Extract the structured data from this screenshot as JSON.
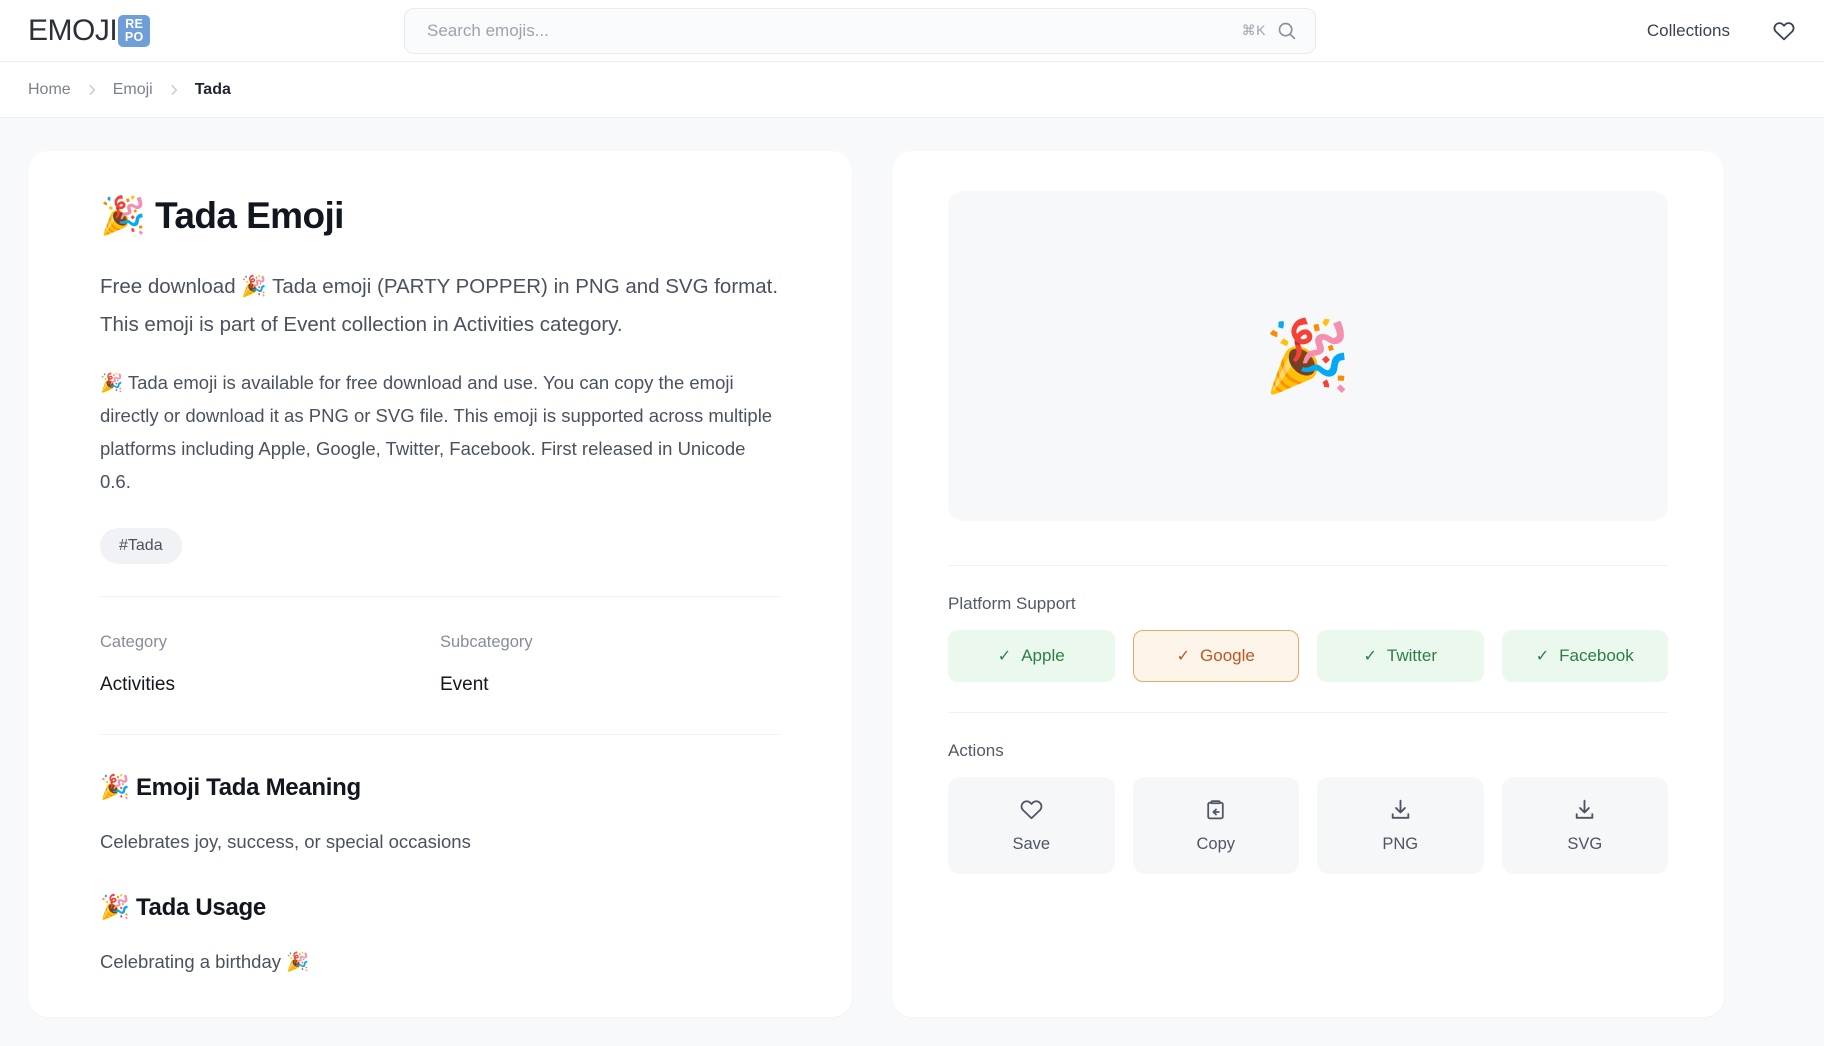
{
  "header": {
    "logo_word": "EMOJI",
    "logo_badge_line1": "RE",
    "logo_badge_line2": "PO",
    "logo_badge_color": "#6f9fd8",
    "search": {
      "placeholder": "Search emojis...",
      "value": "",
      "shortcut": "⌘K",
      "icon": "search-icon"
    },
    "nav": {
      "collections_label": "Collections",
      "favorites_icon": "heart-icon"
    }
  },
  "breadcrumb": {
    "items": [
      {
        "label": "Home",
        "current": false
      },
      {
        "label": "Emoji",
        "current": false
      },
      {
        "label": "Tada",
        "current": true
      }
    ],
    "separator_icon": "chevron-right-icon"
  },
  "left_panel": {
    "title_emoji": "🎉",
    "title": "Tada Emoji",
    "lede": "Free download 🎉 Tada emoji (PARTY POPPER) in PNG and SVG format. This emoji is part of Event collection in Activities category.",
    "body": "🎉 Tada emoji is available for free download and use. You can copy the emoji directly or download it as PNG or SVG file. This emoji is supported across multiple platforms including Apple, Google, Twitter, Facebook. First released in Unicode 0.6.",
    "tags": [
      "#Tada"
    ],
    "meta": [
      {
        "label": "Category",
        "value": "Activities"
      },
      {
        "label": "Subcategory",
        "value": "Event"
      }
    ],
    "sections": [
      {
        "emoji": "🎉",
        "title": "Emoji Tada Meaning",
        "text": "Celebrates joy, success, or special occasions"
      },
      {
        "emoji": "🎉",
        "title": "Tada Usage",
        "text": "Celebrating a birthday 🎉"
      }
    ]
  },
  "right_panel": {
    "preview_emoji": "🎉",
    "platform_support_label": "Platform Support",
    "platforms": [
      {
        "name": "Apple",
        "check": "✓",
        "state": "supported",
        "color": "#2f7d45"
      },
      {
        "name": "Google",
        "check": "✓",
        "state": "highlight",
        "color": "#c05621"
      },
      {
        "name": "Twitter",
        "check": "✓",
        "state": "supported",
        "color": "#2f7d45"
      },
      {
        "name": "Facebook",
        "check": "✓",
        "state": "supported",
        "color": "#2f7d45"
      }
    ],
    "actions_label": "Actions",
    "actions": [
      {
        "label": "Save",
        "icon": "heart-icon"
      },
      {
        "label": "Copy",
        "icon": "clipboard-copy-icon"
      },
      {
        "label": "PNG",
        "icon": "download-icon"
      },
      {
        "label": "SVG",
        "icon": "download-icon"
      }
    ]
  }
}
